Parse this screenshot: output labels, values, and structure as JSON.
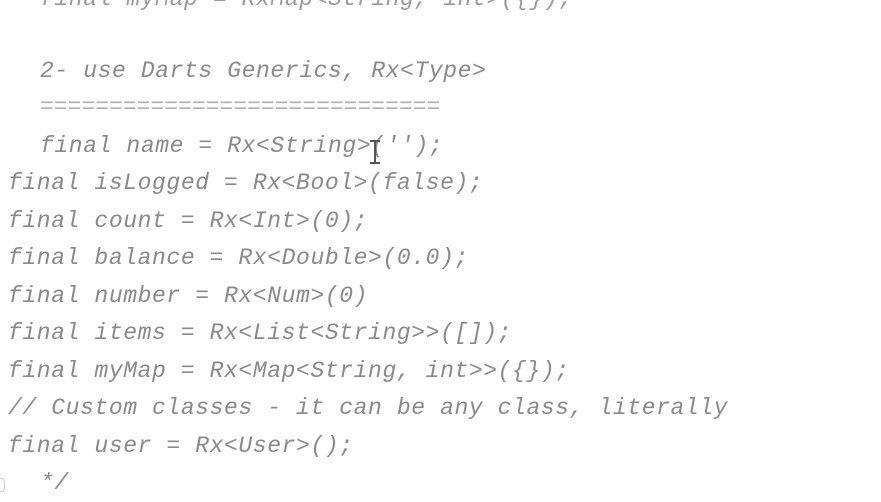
{
  "lines": {
    "cut": "final myMap = RxMap<String, int>({});",
    "heading": "2- use Darts Generics, Rx<Type>",
    "separator": "=============================",
    "name": "final name = Rx<String>('');",
    "is_logged": "final isLogged = Rx<Bool>(false);",
    "count": "final count = Rx<Int>(0);",
    "balance": "final balance = Rx<Double>(0.0);",
    "number": "final number = Rx<Num>(0)",
    "items": "final items = Rx<List<String>>([]);",
    "my_map": "final myMap = Rx<Map<String, int>>({});",
    "comment": "// Custom classes - it can be any class, literally",
    "user": "final user = Rx<User>();",
    "close": "*/"
  },
  "colors": {
    "text": "#8a8a8a",
    "background": "#fefefe"
  },
  "icons": {
    "cursor": "text-cursor-icon"
  }
}
